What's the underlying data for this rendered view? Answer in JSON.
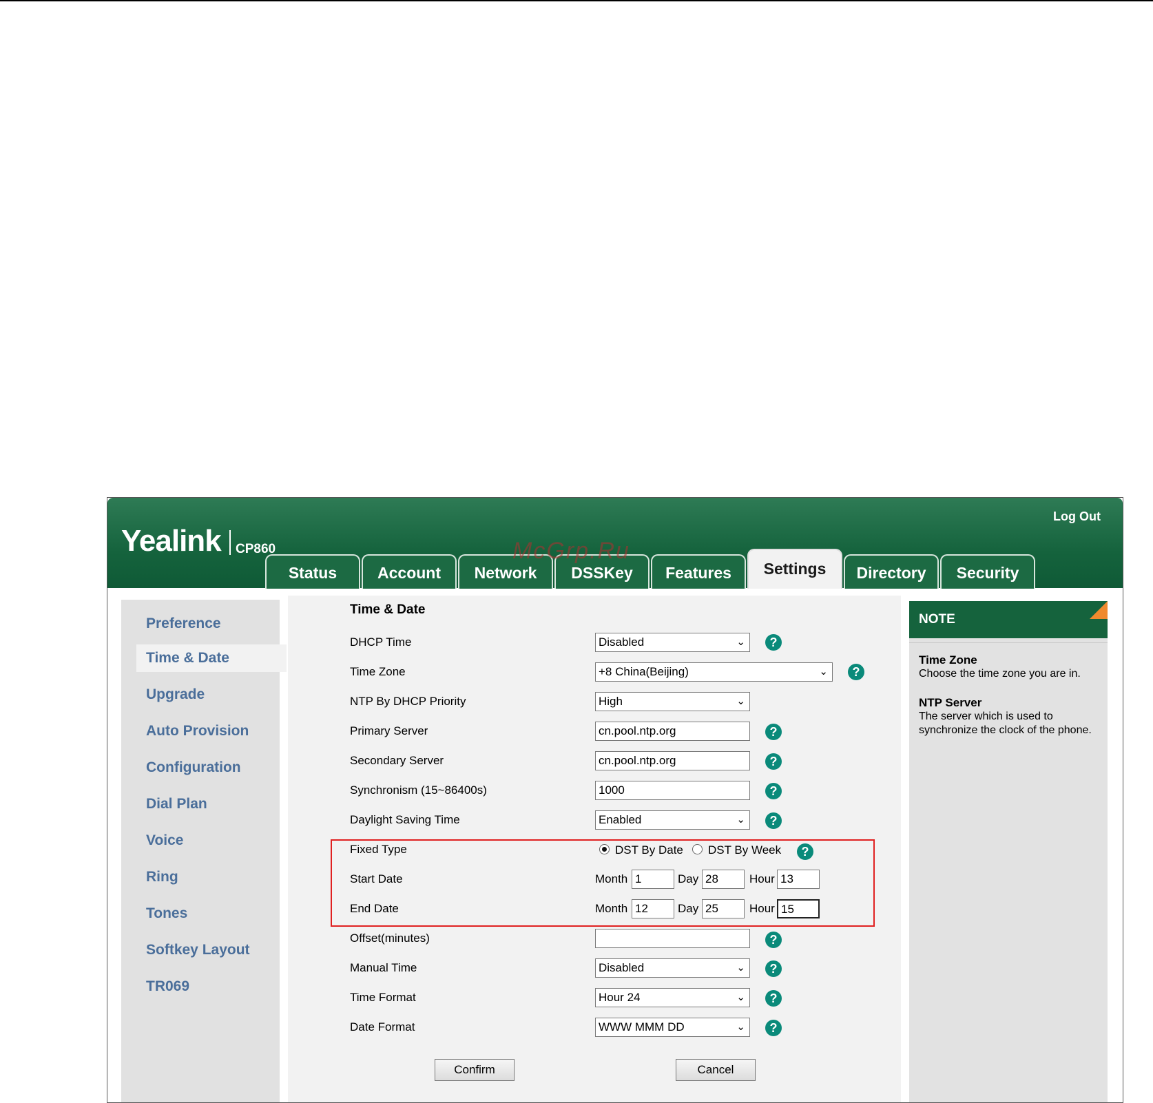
{
  "header": {
    "logout": "Log Out",
    "logo": "Yealink",
    "model": "CP860",
    "watermark": "McGrp.Ru"
  },
  "tabs": [
    {
      "label": "Status"
    },
    {
      "label": "Account"
    },
    {
      "label": "Network"
    },
    {
      "label": "DSSKey"
    },
    {
      "label": "Features"
    },
    {
      "label": "Settings",
      "active": true
    },
    {
      "label": "Directory"
    },
    {
      "label": "Security"
    }
  ],
  "sidebar": {
    "items": [
      {
        "label": "Preference"
      },
      {
        "label": "Time & Date",
        "active": true
      },
      {
        "label": "Upgrade"
      },
      {
        "label": "Auto Provision"
      },
      {
        "label": "Configuration"
      },
      {
        "label": "Dial Plan"
      },
      {
        "label": "Voice"
      },
      {
        "label": "Ring"
      },
      {
        "label": "Tones"
      },
      {
        "label": "Softkey Layout"
      },
      {
        "label": "TR069"
      }
    ]
  },
  "form": {
    "title": "Time & Date",
    "dhcp_time": {
      "label": "DHCP Time",
      "value": "Disabled"
    },
    "time_zone": {
      "label": "Time Zone",
      "value": "+8 China(Beijing)"
    },
    "ntp_priority": {
      "label": "NTP By DHCP Priority",
      "value": "High"
    },
    "primary_server": {
      "label": "Primary Server",
      "value": "cn.pool.ntp.org"
    },
    "secondary_server": {
      "label": "Secondary Server",
      "value": "cn.pool.ntp.org"
    },
    "synchronism": {
      "label": "Synchronism (15~86400s)",
      "value": "1000"
    },
    "dst": {
      "label": "Daylight Saving Time",
      "value": "Enabled"
    },
    "fixed_type": {
      "label": "Fixed Type",
      "option1": "DST By Date",
      "option2": "DST By Week",
      "selected": "DST By Date"
    },
    "start_date": {
      "label": "Start Date",
      "month_label": "Month",
      "month": "1",
      "day_label": "Day",
      "day": "28",
      "hour_label": "Hour",
      "hour": "13"
    },
    "end_date": {
      "label": "End Date",
      "month_label": "Month",
      "month": "12",
      "day_label": "Day",
      "day": "25",
      "hour_label": "Hour",
      "hour": "15"
    },
    "offset": {
      "label": "Offset(minutes)",
      "value": ""
    },
    "manual_time": {
      "label": "Manual Time",
      "value": "Disabled"
    },
    "time_format": {
      "label": "Time Format",
      "value": "Hour 24"
    },
    "date_format": {
      "label": "Date Format",
      "value": "WWW MMM DD"
    },
    "confirm": "Confirm",
    "cancel": "Cancel"
  },
  "note": {
    "title": "NOTE",
    "time_zone_title": "Time Zone",
    "time_zone_text": "Choose the time zone you are in.",
    "ntp_title": "NTP Server",
    "ntp_text": "The server which is used to synchronize the clock of the phone."
  },
  "icons": {
    "help": "help-icon",
    "dropdown": "chevron-down-icon"
  },
  "colors": {
    "header_green": "#15633d",
    "sidebar_link": "#4a6e9a",
    "highlight_box": "#e02020",
    "note_corner": "#f08a2e",
    "help_icon": "#0a8a7a"
  }
}
